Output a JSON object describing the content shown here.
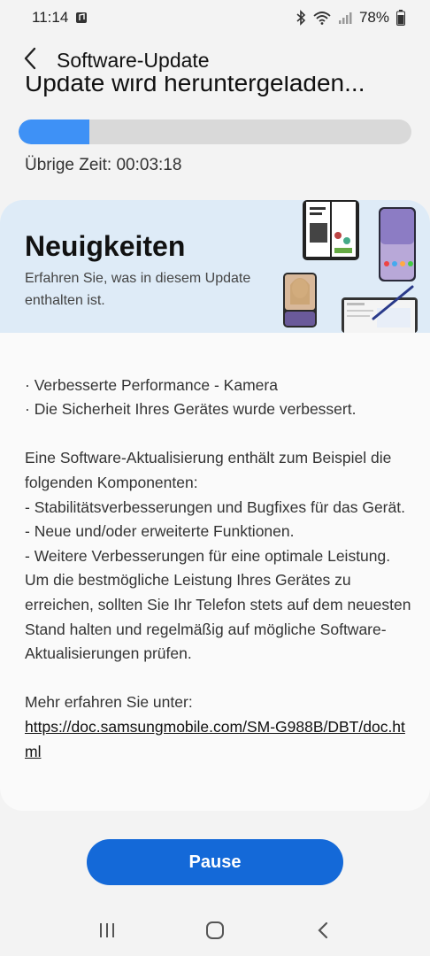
{
  "status_bar": {
    "time": "11:14",
    "battery": "78%",
    "icons": [
      "media-icon",
      "bluetooth-icon",
      "wifi-icon",
      "signal-icon",
      "battery-icon"
    ]
  },
  "header": {
    "title": "Software-Update",
    "back_icon": "chevron-left-icon"
  },
  "download": {
    "status_text": "Update wird heruntergeladen...",
    "progress_fraction": 0.18,
    "remaining_time": "Übrige Zeit: 00:03:18"
  },
  "news": {
    "title": "Neuigkeiten",
    "subtitle": "Erfahren Sie, was in diesem Update enthalten ist.",
    "body": "· Verbesserte Performance - Kamera\n· Die Sicherheit Ihres Gerätes wurde verbessert.\n\nEine Software-Aktualisierung enthält zum Beispiel die folgenden Komponenten:\n - Stabilitätsverbesserungen und Bugfixes für das Gerät.\n - Neue und/oder erweiterte Funktionen.\n - Weitere Verbesserungen für eine optimale Leistung.\nUm die bestmögliche Leistung Ihres Gerätes zu erreichen, sollten Sie Ihr Telefon stets auf dem neuesten Stand halten und regelmäßig auf mögliche Software-Aktualisierungen prüfen.\n\nMehr erfahren Sie unter:",
    "link": "https://doc.samsungmobile.com/SM-G988B/DBT/doc.html"
  },
  "actions": {
    "pause_label": "Pause"
  },
  "nav_bar": {
    "icons": [
      "recent-apps-icon",
      "home-icon",
      "back-icon"
    ]
  },
  "colors": {
    "accent": "#1469d8",
    "progress": "#3e91f6",
    "banner": "#deebf7"
  }
}
